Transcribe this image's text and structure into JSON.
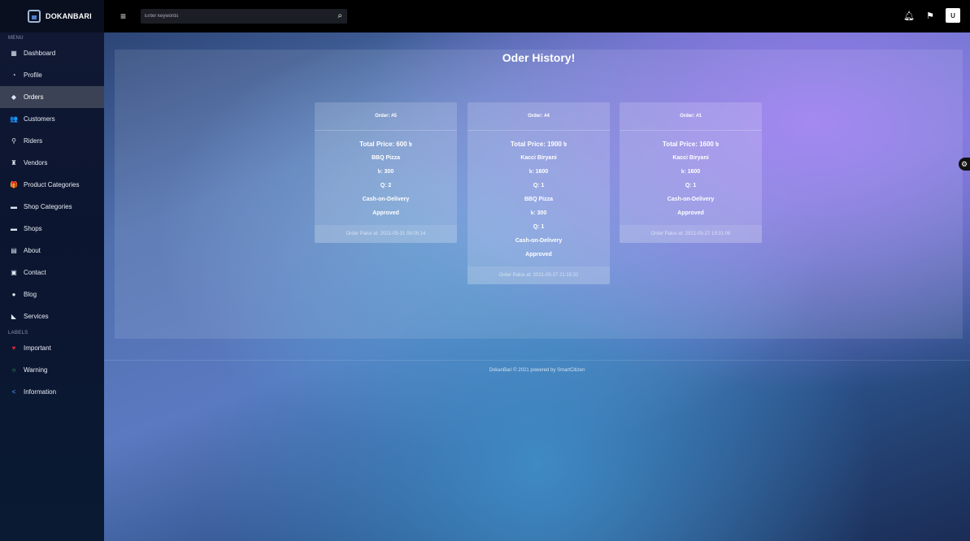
{
  "brand": {
    "name": "DOKANBARI",
    "logo_icon": "store-icon"
  },
  "search": {
    "placeholder": "Enter keywords"
  },
  "sidebar": {
    "menu_label": "MENU",
    "labels_label": "LABELS",
    "items": [
      {
        "label": "Dashboard",
        "icon": "dashboard-icon",
        "glyph": "▦",
        "active": false
      },
      {
        "label": "Profile",
        "icon": "user-circle-icon",
        "glyph": "◔",
        "active": false
      },
      {
        "label": "Orders",
        "icon": "tag-icon",
        "glyph": "◆",
        "active": true
      },
      {
        "label": "Customers",
        "icon": "users-icon",
        "glyph": "👥",
        "active": false
      },
      {
        "label": "Riders",
        "icon": "bicycle-icon",
        "glyph": "⚲",
        "active": false
      },
      {
        "label": "Vendors",
        "icon": "dolly-icon",
        "glyph": "♜",
        "active": false
      },
      {
        "label": "Product Categories",
        "icon": "gift-icon",
        "glyph": "🎁",
        "active": false
      },
      {
        "label": "Shop Categories",
        "icon": "store-icon",
        "glyph": "▬",
        "active": false
      },
      {
        "label": "Shops",
        "icon": "store-icon",
        "glyph": "▬",
        "active": false
      },
      {
        "label": "About",
        "icon": "id-card-icon",
        "glyph": "▤",
        "active": false
      },
      {
        "label": "Contact",
        "icon": "address-book-icon",
        "glyph": "▣",
        "active": false
      },
      {
        "label": "Blog",
        "icon": "blog-icon",
        "glyph": "●",
        "active": false
      },
      {
        "label": "Services",
        "icon": "services-icon",
        "glyph": "◣",
        "active": false
      }
    ],
    "labels": [
      {
        "label": "Important",
        "icon": "heart-icon",
        "glyph": "♥",
        "color": "red"
      },
      {
        "label": "Warning",
        "icon": "circle-icon",
        "glyph": "○",
        "color": "green"
      },
      {
        "label": "Information",
        "icon": "share-icon",
        "glyph": "<",
        "color": "blue"
      }
    ]
  },
  "main": {
    "title": "Oder History!",
    "orders": [
      {
        "header": "Order: #5",
        "total": "Total Price: 600 ৳",
        "items": [
          {
            "name": "BBQ Pizza",
            "price": "৳: 300",
            "qty": "Q: 2"
          }
        ],
        "payment": "Cash-on-Delivery",
        "status": "Approved",
        "placed": "Order Palce at: 2021-05-31 08:05:14"
      },
      {
        "header": "Order: #4",
        "total": "Total Price: 1900 ৳",
        "items": [
          {
            "name": "Kacci Biryani",
            "price": "৳: 1600",
            "qty": "Q: 1"
          },
          {
            "name": "BBQ Pizza",
            "price": "৳: 300",
            "qty": "Q: 1"
          }
        ],
        "payment": "Cash-on-Delivery",
        "status": "Approved",
        "placed": "Order Palce at: 2021-05-27 21:15:32"
      },
      {
        "header": "Order: #1",
        "total": "Total Price: 1600 ৳",
        "items": [
          {
            "name": "Kacci Biryani",
            "price": "৳: 1600",
            "qty": "Q: 1"
          }
        ],
        "payment": "Cash-on-Delivery",
        "status": "Approved",
        "placed": "Order Palce at: 2021-05-27 19:31:06"
      }
    ]
  },
  "footer": {
    "text": "DokanBari © 2021 powered by SmartCitizen"
  },
  "topbar": {
    "avatar_text": "U"
  }
}
